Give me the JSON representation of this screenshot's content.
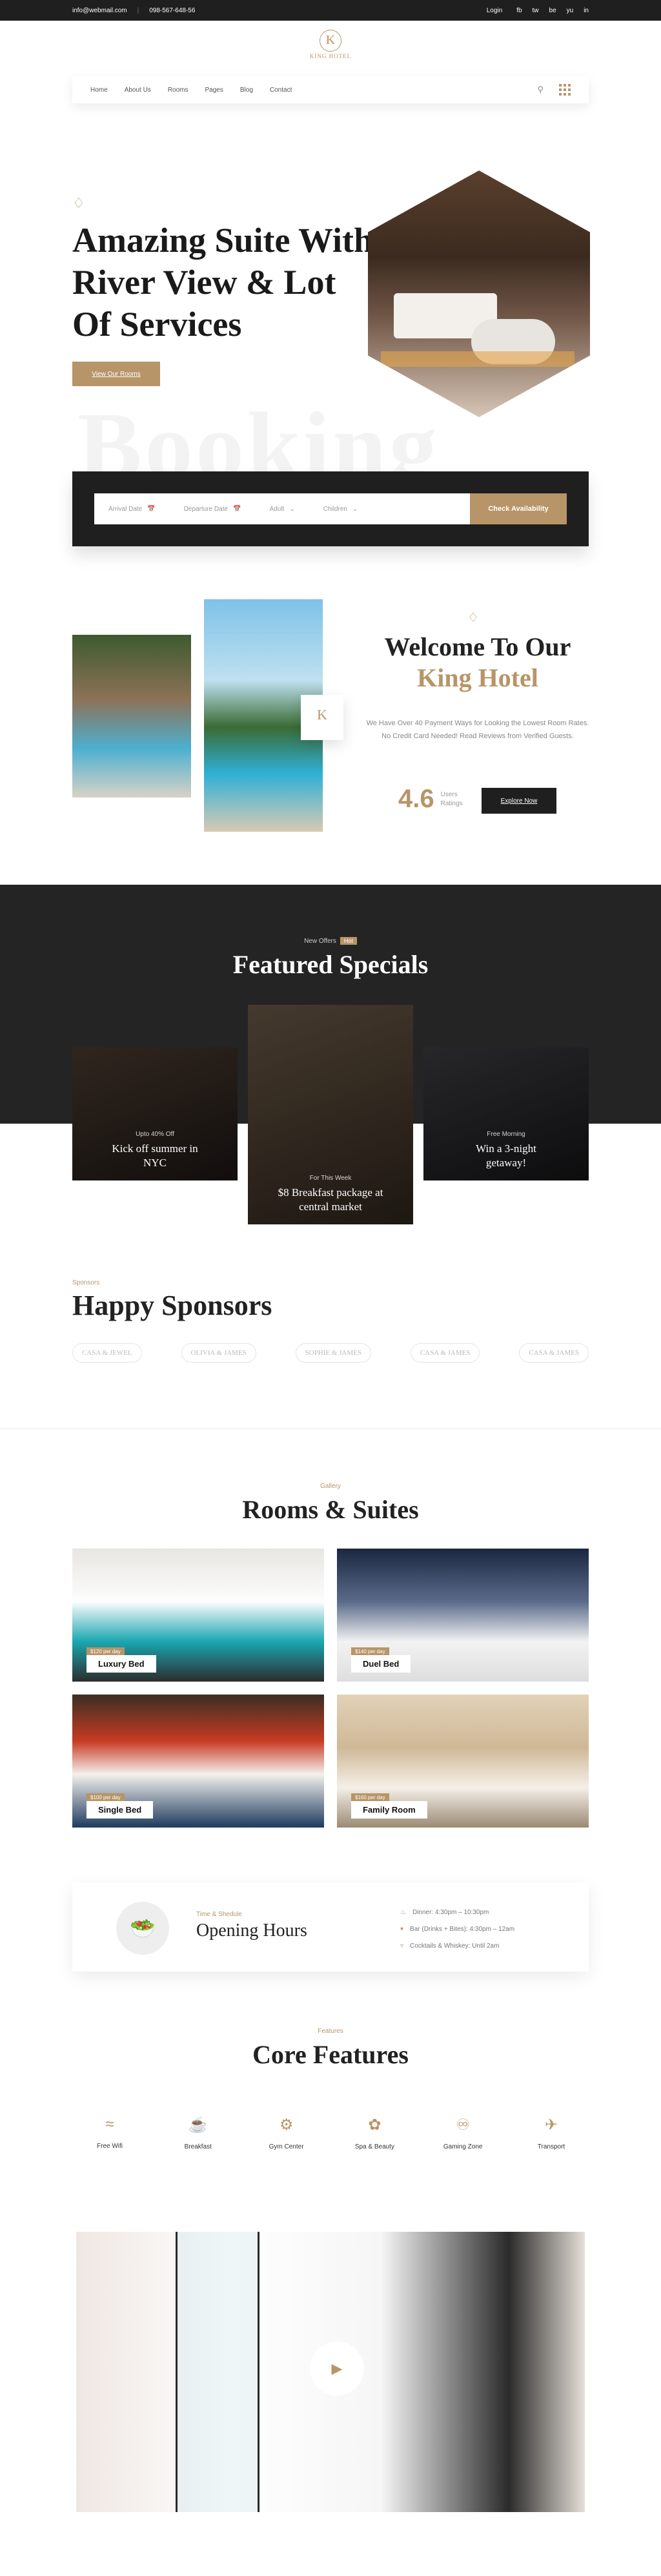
{
  "topbar": {
    "email": "info@webmail.com",
    "phone": "098-567-648-56",
    "login": "Login",
    "social": [
      "fb",
      "tw",
      "be",
      "yu",
      "in"
    ]
  },
  "logo": {
    "letter": "K",
    "name": "KING HOTEL"
  },
  "nav": {
    "items": [
      "Home",
      "About Us",
      "Rooms",
      "Pages",
      "Blog",
      "Contact"
    ]
  },
  "hero": {
    "title": "Amazing Suite With River View & Lot Of Services",
    "button": "View Our Rooms",
    "ghost": "Booking"
  },
  "booking": {
    "arrival": "Arrival Date",
    "departure": "Departure Date",
    "adult": "Adult",
    "children": "Children",
    "button": "Check Availability"
  },
  "welcome": {
    "title": "Welcome To Our",
    "title_gold": "King Hotel",
    "text": "We Have Over 40 Payment Ways for Looking the Lowest Room Rates. No Credit Card Needed! Read Reviews from Verified Guests.",
    "rating": "4.6",
    "rating_label": "Users Ratings",
    "button": "Explore Now"
  },
  "specials": {
    "label": "New Offers",
    "tag": "Hot",
    "title": "Featured Specials",
    "cards": [
      {
        "small": "Upto 40% Off",
        "big": "Kick off summer in NYC"
      },
      {
        "small": "For This Week",
        "big": "$8 Breakfast package at central market"
      },
      {
        "small": "Free Morning",
        "big": "Win a 3-night getaway!"
      }
    ]
  },
  "sponsors": {
    "label": "Sponsors",
    "title": "Happy Sponsors",
    "logos": [
      "CASA & JEWEL",
      "OLIVIA & JAMES",
      "SOPHIE & JAMES",
      "CASA & JAMES",
      "CASA & JAMES"
    ]
  },
  "gallery": {
    "label": "Gallery",
    "title": "Rooms & Suites",
    "rooms": [
      {
        "price": "$120 per day",
        "name": "Luxury Bed"
      },
      {
        "price": "$140 per day",
        "name": "Duel Bed"
      },
      {
        "price": "$100 per day",
        "name": "Single Bed"
      },
      {
        "price": "$160 per day",
        "name": "Family Room"
      }
    ]
  },
  "hours": {
    "label": "Time & Shedule",
    "title": "Opening Hours",
    "items": [
      "Dinner: 4:30pm – 10:30pm",
      "Bar (Drinks + Bites): 4:30pm – 12am",
      "Cocktails & Whiskey: Until 2am"
    ]
  },
  "features": {
    "label": "Features",
    "title": "Core Features",
    "items": [
      {
        "icon": "wifi-icon",
        "label": "Free Wifi"
      },
      {
        "icon": "breakfast-icon",
        "label": "Breakfast"
      },
      {
        "icon": "gym-icon",
        "label": "Gym Center"
      },
      {
        "icon": "spa-icon",
        "label": "Spa & Beauty"
      },
      {
        "icon": "gaming-icon",
        "label": "Gaming Zone"
      },
      {
        "icon": "transport-icon",
        "label": "Transport"
      }
    ]
  },
  "colors": {
    "gold": "#b79568",
    "dark": "#1f1f1f"
  }
}
